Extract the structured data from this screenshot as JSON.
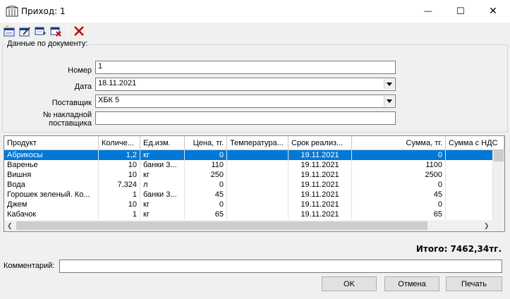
{
  "window": {
    "title": "Приход: 1",
    "minimize_glyph": "—",
    "maximize_glyph": "☐",
    "close_glyph": "✕"
  },
  "toolbar": {
    "icons": [
      "new-document-icon",
      "edit-document-icon",
      "add-row-icon",
      "delete-row-icon",
      "delete-icon"
    ]
  },
  "document": {
    "group_label": "Данные по документу:",
    "number_label": "Номер",
    "number_value": "1",
    "date_label": "Дата",
    "date_value": "18.11.2021",
    "supplier_label": "Поставщик",
    "supplier_value": "ХБК 5",
    "invoice_label_1": "№ накладной",
    "invoice_label_2": "поставщика",
    "invoice_value": ""
  },
  "grid": {
    "columns": [
      "Продукт",
      "Количе...",
      "Ед.изм.",
      "Цена, тг.",
      "Температура...",
      "Срок реализ...",
      "Сумма, тг.",
      "Сумма с НДС"
    ],
    "rows": [
      [
        "Абрикосы",
        "1,2",
        "кг",
        "0",
        "",
        "19.11.2021",
        "0",
        ""
      ],
      [
        "Варенье",
        "10",
        "банки 3...",
        "110",
        "",
        "19.11.2021",
        "1100",
        ""
      ],
      [
        "Вишня",
        "10",
        "кг",
        "250",
        "",
        "19.11.2021",
        "2500",
        ""
      ],
      [
        "Вода",
        "7,324",
        "л",
        "0",
        "",
        "19.11.2021",
        "0",
        ""
      ],
      [
        "Горошек зеленый. Ко...",
        "1",
        "банки 3...",
        "45",
        "",
        "19.11.2021",
        "45",
        ""
      ],
      [
        "Джем",
        "10",
        "кг",
        "0",
        "",
        "19.11.2021",
        "0",
        ""
      ],
      [
        "Кабачок",
        "1",
        "кг",
        "65",
        "",
        "19.11.2021",
        "65",
        ""
      ]
    ],
    "selected_row": 0
  },
  "footer": {
    "total": "Итого: 7462,34тг.",
    "comment_label": "Комментарий:",
    "comment_value": "",
    "ok_label": "OK",
    "cancel_label": "Отмена",
    "print_label": "Печать"
  }
}
